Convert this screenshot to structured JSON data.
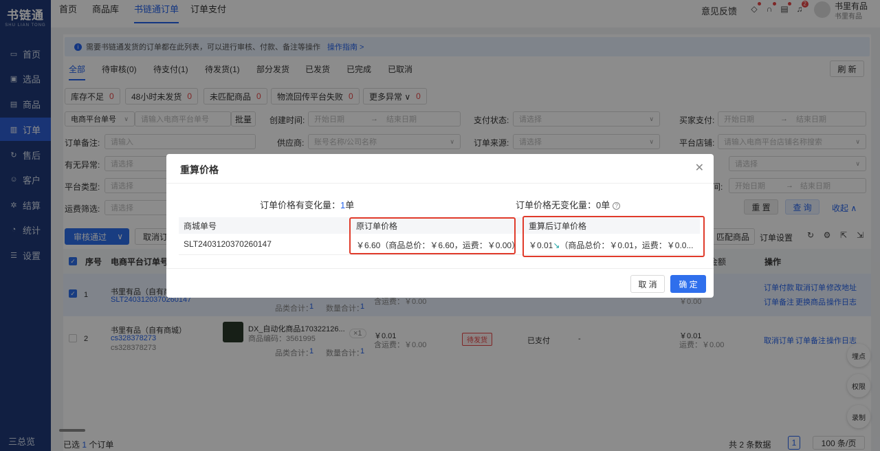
{
  "sidebar": {
    "logo_cn": "书链通",
    "logo_en": "SHU LIAN TONG",
    "items": [
      {
        "label": "首页",
        "icon": "monitor-icon"
      },
      {
        "label": "选品",
        "icon": "select-icon"
      },
      {
        "label": "商品",
        "icon": "goods-icon"
      },
      {
        "label": "订单",
        "icon": "order-icon"
      },
      {
        "label": "售后",
        "icon": "aftersale-icon"
      },
      {
        "label": "客户",
        "icon": "customer-icon"
      },
      {
        "label": "结算",
        "icon": "settle-icon"
      },
      {
        "label": "统计",
        "icon": "stats-icon"
      },
      {
        "label": "设置",
        "icon": "settings-icon"
      }
    ],
    "active_index": 3,
    "bottom": "三总览"
  },
  "topbar": {
    "nav": [
      "首页",
      "商品库",
      "书链通订单",
      "订单支付"
    ],
    "active_nav": 2,
    "feedback": "意见反馈",
    "notification_count": "2",
    "user_name": "书里有品",
    "user_shop": "书里有品"
  },
  "notice": {
    "text": "需要书链通发货的订单都在此列表，可以进行审核、付款、备注等操作",
    "link": "操作指南 >"
  },
  "status_tabs": [
    "全部",
    "待审核(0)",
    "待支付(1)",
    "待发货(1)",
    "部分发货",
    "已发货",
    "已完成",
    "已取消"
  ],
  "refresh": "刷 新",
  "chips": [
    {
      "label": "库存不足",
      "count": "0"
    },
    {
      "label": "48小时未发货",
      "count": "0"
    },
    {
      "label": "未匹配商品",
      "count": "0"
    },
    {
      "label": "物流回传平台失败",
      "count": "0"
    },
    {
      "label": "更多异常 ∨",
      "count": "0"
    }
  ],
  "filters": {
    "platform_order_select": "电商平台单号",
    "platform_order_ph": "请输入电商平台单号",
    "batch": "批量",
    "create_time": "创建时间:",
    "start_date": "开始日期",
    "end_date": "结束日期",
    "pay_status": "支付状态:",
    "please_select": "请选择",
    "buyer_pay": "买家支付:",
    "order_remark": "订单备注:",
    "please_input": "请输入",
    "supplier": "供应商:",
    "supplier_ph": "账号名称/公司名称",
    "order_source": "订单来源:",
    "shop": "平台店铺:",
    "shop_ph": "请输入电商平台店铺名称搜索",
    "has_exception": "有无异常:",
    "platform_type": "平台类型:",
    "shipping_filter": "运费筛选:",
    "time_label": "间:",
    "reset": "重 置",
    "query": "查 询",
    "collapse": "收起 ∧"
  },
  "actions": {
    "approve": "审核通过",
    "cancel_order": "取消订",
    "match": "匹配商品",
    "order_settings": "订单设置"
  },
  "table": {
    "headers": [
      "序号",
      "电商平台订单号",
      "金额",
      "操作"
    ],
    "rows": [
      {
        "index": "1",
        "shop": "书里有品（自有商城）",
        "order_no": "SLT2403120370260147",
        "category_total_label": "品类合计：",
        "category_total": "1",
        "qty_total_label": "数量合计：",
        "qty_total": "1",
        "freight": "含运费：￥0.00",
        "amount": "￥0.00",
        "ops": [
          "订单付款",
          "取消订单",
          "修改地址",
          "订单备注",
          "更换商品",
          "操作日志"
        ]
      },
      {
        "index": "2",
        "shop": "书里有品（自有商城）",
        "order_no": "cs328378273",
        "order_no2": "cs328378273",
        "product_name": "DX_自动化商品170322126...",
        "product_code": "商品编码：3561995",
        "qty": "×1",
        "price": "￥0.01",
        "freight": "含运费：￥0.00",
        "status": "待发货",
        "pay": "已支付",
        "dash": "-",
        "amount": "￥0.01",
        "amount_freight": "运费：￥0.00",
        "category_total_label": "品类合计：",
        "category_total": "1",
        "qty_total_label": "数量合计：",
        "qty_total": "1",
        "ops": [
          "取消订单",
          "订单备注",
          "操作日志"
        ]
      }
    ]
  },
  "footer": {
    "selected_prefix": "已选",
    "selected_count": "1",
    "selected_suffix": "个订单",
    "total": "共 2 条数据",
    "page": "1",
    "page_size": "100 条/页"
  },
  "float_buttons": [
    "埋点",
    "权限",
    "录制"
  ],
  "modal": {
    "title": "重算价格",
    "changed_label": "订单价格有变化量：",
    "changed_count": "1",
    "changed_unit": "单",
    "unchanged_label": "订单价格无变化量：",
    "unchanged_count": "0单",
    "columns": [
      "商城单号",
      "原订单价格",
      "重算后订单价格"
    ],
    "row": {
      "order_no": "SLT2403120370260147",
      "original": "￥6.60（商品总价：￥6.60，运费：￥0.00）",
      "recalc": "￥0.01",
      "recalc_detail": "（商品总价：￥0.01，运费：￥0.0..."
    },
    "cancel": "取 消",
    "confirm": "确 定"
  }
}
